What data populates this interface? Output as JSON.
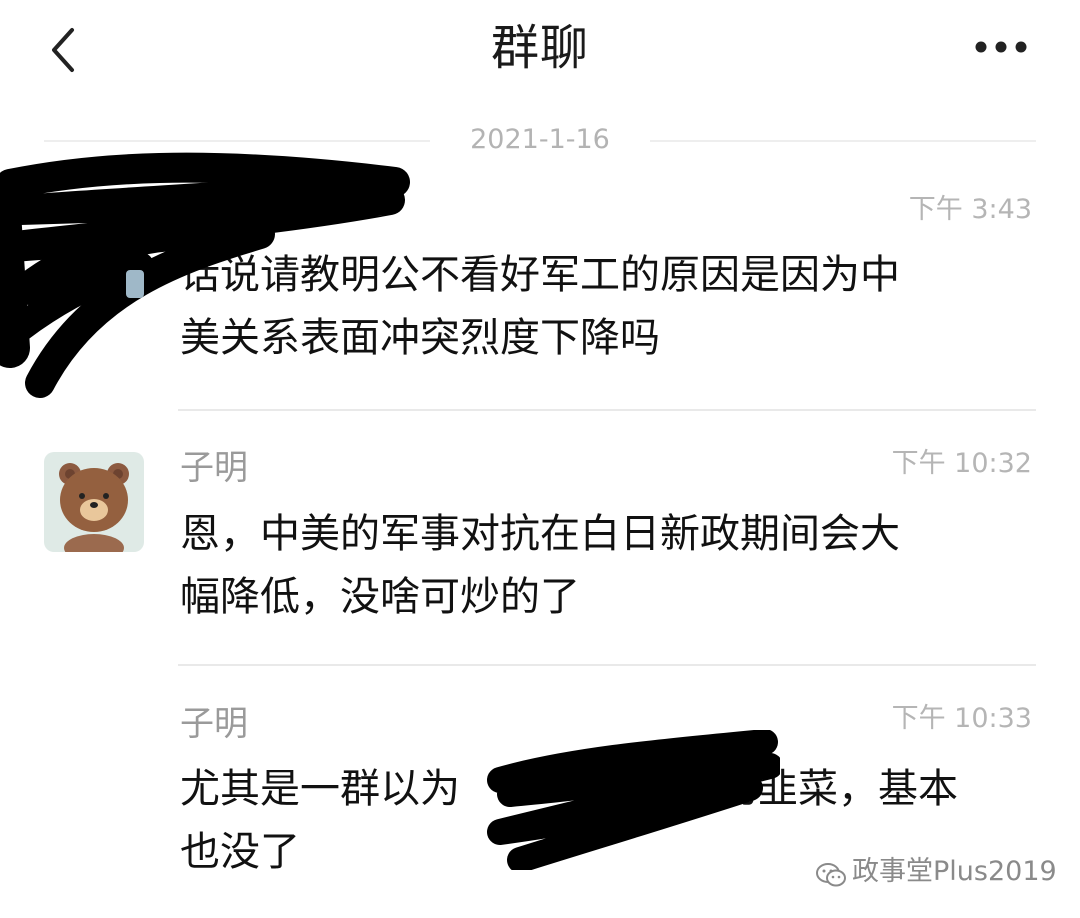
{
  "header": {
    "title": "群聊",
    "back_icon": "chevron-left-icon",
    "more_icon": "more-horizontal-icon"
  },
  "date_separator": "2021-1-16",
  "messages": [
    {
      "sender": "",
      "time": "下午 3:43",
      "text": "话说请教明公不看好军工的原因是因为中\n美关系表面冲突烈度下降吗",
      "redacted": true
    },
    {
      "sender": "子明",
      "time": "下午 10:32",
      "text": "恩，中美的军事对抗在白日新政期间会大\n幅降低，没啥可炒的了",
      "avatar": "bear-avatar"
    },
    {
      "sender": "子明",
      "time": "下午 10:33",
      "text_before": "尤其是一群以为",
      "text_after": "的韭菜，基本",
      "text_line2": "也没了"
    }
  ],
  "watermark": {
    "icon": "wechat-icon",
    "text": "政事堂Plus2019"
  },
  "colors": {
    "text": "#111111",
    "meta": "#b5b5b5",
    "sender": "#9a9a9a",
    "divider": "#e9e9e9",
    "redaction": "#000000"
  }
}
